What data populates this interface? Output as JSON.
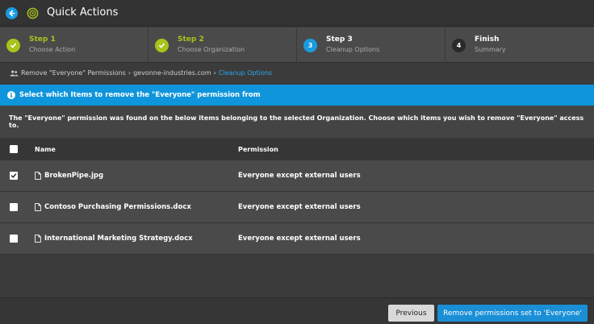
{
  "header": {
    "title": "Quick Actions"
  },
  "steps": [
    {
      "badge": "",
      "title": "Step 1",
      "subtitle": "Choose Action",
      "state": "done",
      "color": "#a8c31c"
    },
    {
      "badge": "",
      "title": "Step 2",
      "subtitle": "Choose Organization",
      "state": "done",
      "color": "#a8c31c"
    },
    {
      "badge": "3",
      "title": "Step 3",
      "subtitle": "Cleanup Options",
      "state": "active",
      "color": "#1a9be0"
    },
    {
      "badge": "4",
      "title": "Finish",
      "subtitle": "Summary",
      "state": "pending",
      "color": "#2a2a2a"
    }
  ],
  "breadcrumb": {
    "item1": "Remove \"Everyone\" Permissions",
    "item2": "gevonne-industries.com",
    "item3": "Cleanup Options"
  },
  "banner": {
    "text": "Select which Items to remove the \"Everyone\" permission from"
  },
  "description": "The \"Everyone\" permission was found on the below items belonging to the selected Organization. Choose which items you wish to remove \"Everyone\" access to.",
  "table": {
    "headers": {
      "name": "Name",
      "permission": "Permission"
    },
    "rows": [
      {
        "name": "BrokenPipe.jpg",
        "permission": "Everyone except external users",
        "checked": true
      },
      {
        "name": "Contoso Purchasing Permissions.docx",
        "permission": "Everyone except external users",
        "checked": false
      },
      {
        "name": "International Marketing Strategy.docx",
        "permission": "Everyone except external users",
        "checked": false
      }
    ]
  },
  "footer": {
    "previous_label": "Previous",
    "remove_label": "Remove permissions set to 'Everyone'"
  },
  "colors": {
    "accent_blue": "#1a9be0",
    "step_green": "#a8c31c",
    "link_blue": "#29a8ef"
  }
}
